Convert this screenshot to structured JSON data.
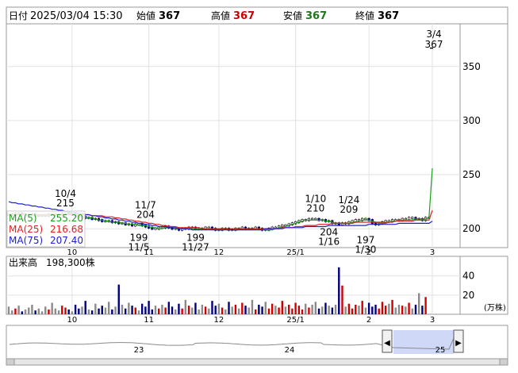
{
  "header": {
    "date_label": "日付",
    "date_value": "2025/03/04 15:30",
    "open_label": "始値",
    "open_value": "367",
    "high_label": "高値",
    "high_value": "367",
    "low_label": "安値",
    "low_value": "367",
    "close_label": "終値",
    "close_value": "367"
  },
  "colors": {
    "up": "#d00000",
    "down": "#00007c",
    "ma5": "#1e9e1e",
    "ma25": "#e02020",
    "ma75": "#2020d0",
    "low_green": "#1a7a1a"
  },
  "chart_data": [
    {
      "type": "line",
      "title": "",
      "y_ticks": [
        "350",
        "300",
        "250",
        "200"
      ],
      "y_tick_values": [
        350,
        300,
        250,
        200
      ],
      "ylim": [
        184,
        388
      ],
      "x_ticks": [
        "10",
        "11",
        "12",
        "25/1",
        "2",
        "3"
      ],
      "x_tick_index": [
        19,
        42,
        63,
        86,
        108,
        127
      ],
      "close": [
        213,
        213,
        214,
        214,
        213,
        213,
        213,
        213,
        212,
        212,
        212,
        212,
        213,
        213,
        213,
        213,
        214,
        215,
        214,
        214,
        212,
        211,
        211,
        210,
        210,
        209,
        209,
        208,
        207,
        207,
        207,
        206,
        206,
        205,
        205,
        204,
        204,
        203,
        204,
        204,
        203,
        202,
        201,
        200,
        200,
        201,
        201,
        202,
        201,
        200,
        200,
        199,
        200,
        200,
        201,
        201,
        200,
        200,
        200,
        201,
        201,
        200,
        199,
        199,
        200,
        200,
        199,
        199,
        200,
        200,
        201,
        200,
        200,
        200,
        201,
        200,
        199,
        199,
        200,
        201,
        201,
        202,
        203,
        203,
        204,
        205,
        206,
        207,
        208,
        208,
        209,
        209,
        209,
        208,
        208,
        207,
        207,
        205,
        205,
        204,
        205,
        205,
        206,
        207,
        208,
        208,
        209,
        209,
        208,
        205,
        204,
        205,
        206,
        207,
        207,
        208,
        208,
        208,
        209,
        209,
        210,
        210,
        209,
        209,
        208,
        210,
        210,
        367
      ],
      "series": [
        {
          "name": "MA(5)",
          "value": "255.20",
          "values": [
            213,
            213,
            213,
            213,
            213,
            213,
            213,
            213,
            212,
            212,
            212,
            212,
            212,
            213,
            213,
            213,
            213,
            214,
            214,
            214,
            213,
            212,
            211,
            211,
            210,
            210,
            209,
            208,
            208,
            207,
            207,
            206,
            206,
            206,
            205,
            205,
            204,
            204,
            204,
            203,
            203,
            203,
            202,
            201,
            201,
            200,
            200,
            201,
            201,
            201,
            200,
            200,
            200,
            200,
            200,
            200,
            200,
            200,
            200,
            200,
            200,
            200,
            200,
            200,
            200,
            200,
            199,
            199,
            199,
            199,
            200,
            200,
            200,
            200,
            200,
            200,
            200,
            199,
            199,
            199,
            200,
            201,
            202,
            202,
            203,
            204,
            205,
            206,
            207,
            208,
            208,
            208,
            208,
            208,
            208,
            207,
            207,
            206,
            205,
            205,
            205,
            205,
            205,
            206,
            206,
            207,
            208,
            208,
            208,
            207,
            206,
            205,
            205,
            205,
            206,
            207,
            207,
            208,
            208,
            208,
            208,
            208,
            209,
            209,
            209,
            209,
            210,
            256
          ]
        },
        {
          "name": "MA(25)",
          "value": "216.68",
          "values": [
            213,
            213,
            213,
            213,
            213,
            213,
            213,
            213,
            213,
            213,
            213,
            213,
            213,
            213,
            213,
            213,
            213,
            213,
            213,
            213,
            213,
            213,
            213,
            213,
            213,
            212,
            212,
            212,
            212,
            211,
            211,
            211,
            210,
            210,
            209,
            209,
            208,
            208,
            207,
            207,
            206,
            206,
            205,
            205,
            204,
            204,
            203,
            203,
            202,
            202,
            202,
            201,
            201,
            201,
            201,
            201,
            201,
            201,
            200,
            200,
            200,
            200,
            200,
            200,
            200,
            200,
            200,
            200,
            200,
            200,
            200,
            200,
            200,
            200,
            200,
            200,
            200,
            200,
            200,
            200,
            200,
            200,
            201,
            201,
            201,
            201,
            202,
            202,
            202,
            203,
            203,
            203,
            203,
            204,
            204,
            204,
            204,
            205,
            205,
            205,
            205,
            205,
            205,
            205,
            206,
            206,
            206,
            206,
            206,
            206,
            206,
            206,
            206,
            206,
            206,
            206,
            207,
            207,
            207,
            207,
            207,
            207,
            208,
            208,
            208,
            208,
            208,
            217
          ]
        },
        {
          "name": "MA(75)",
          "value": "207.40",
          "values": [
            225,
            224,
            224,
            223,
            223,
            222,
            222,
            221,
            221,
            220,
            220,
            219,
            219,
            218,
            218,
            217,
            217,
            216,
            216,
            215,
            215,
            214,
            214,
            213,
            213,
            212,
            212,
            211,
            211,
            210,
            210,
            209,
            209,
            208,
            208,
            207,
            207,
            206,
            206,
            205,
            205,
            204,
            204,
            203,
            203,
            202,
            202,
            202,
            201,
            201,
            201,
            200,
            200,
            200,
            200,
            199,
            199,
            199,
            199,
            199,
            199,
            199,
            199,
            199,
            199,
            199,
            199,
            199,
            199,
            199,
            199,
            199,
            199,
            199,
            199,
            199,
            199,
            200,
            200,
            200,
            200,
            200,
            200,
            201,
            201,
            201,
            201,
            201,
            201,
            202,
            202,
            202,
            202,
            202,
            202,
            202,
            203,
            203,
            203,
            203,
            203,
            203,
            203,
            203,
            203,
            203,
            203,
            203,
            204,
            204,
            204,
            204,
            204,
            204,
            204,
            204,
            204,
            205,
            205,
            205,
            205,
            205,
            205,
            205,
            205,
            205,
            205,
            207
          ]
        }
      ],
      "annotations": [
        {
          "date": "10/4",
          "value": "215",
          "index": 17
        },
        {
          "date": "11/7",
          "value": "204",
          "index": 41
        },
        {
          "date": "11/5",
          "value": "199",
          "index": 39
        },
        {
          "date": "11/27",
          "value": "199",
          "index": 56
        },
        {
          "date": "1/10",
          "value": "210",
          "index": 92
        },
        {
          "date": "1/16",
          "value": "204",
          "index": 96
        },
        {
          "date": "1/24",
          "value": "209",
          "index": 102
        },
        {
          "date": "1/30",
          "value": "197",
          "index": 107
        },
        {
          "date": "3/4",
          "value": "367",
          "index": 127
        }
      ]
    },
    {
      "type": "bar",
      "title": "出来高",
      "value": "198,300株",
      "unit": "(万株)",
      "y_ticks": [
        "40",
        "20"
      ],
      "y_tick_values": [
        40,
        20
      ],
      "ylim": [
        0,
        58
      ],
      "x_ticks": [
        "10",
        "11",
        "12",
        "25/1",
        "2",
        "3"
      ],
      "x_tick_index": [
        19,
        42,
        63,
        86,
        108,
        127
      ],
      "values": [
        8,
        4,
        6,
        9,
        3,
        5,
        7,
        10,
        4,
        6,
        3,
        8,
        5,
        12,
        6,
        4,
        9,
        7,
        5,
        3,
        10,
        6,
        8,
        14,
        5,
        4,
        11,
        6,
        9,
        7,
        13,
        5,
        8,
        31,
        10,
        6,
        12,
        9,
        7,
        4,
        11,
        8,
        14,
        5,
        9,
        6,
        10,
        7,
        13,
        8,
        5,
        11,
        6,
        15,
        9,
        7,
        12,
        5,
        10,
        8,
        6,
        14,
        9,
        11,
        7,
        5,
        13,
        8,
        10,
        6,
        12,
        9,
        7,
        15,
        5,
        10,
        8,
        13,
        6,
        11,
        9,
        7,
        14,
        8,
        10,
        6,
        12,
        9,
        5,
        11,
        7,
        10,
        13,
        6,
        8,
        12,
        9,
        7,
        10,
        49,
        30,
        8,
        11,
        6,
        10,
        9,
        14,
        7,
        12,
        8,
        10,
        6,
        13,
        9,
        11,
        15,
        7,
        10,
        9,
        8,
        12,
        6,
        10,
        22,
        9,
        18
      ]
    }
  ],
  "overview": {
    "labels": [
      "23",
      "24",
      "25"
    ],
    "left_arrow": "◀",
    "right_arrow": "▶"
  }
}
